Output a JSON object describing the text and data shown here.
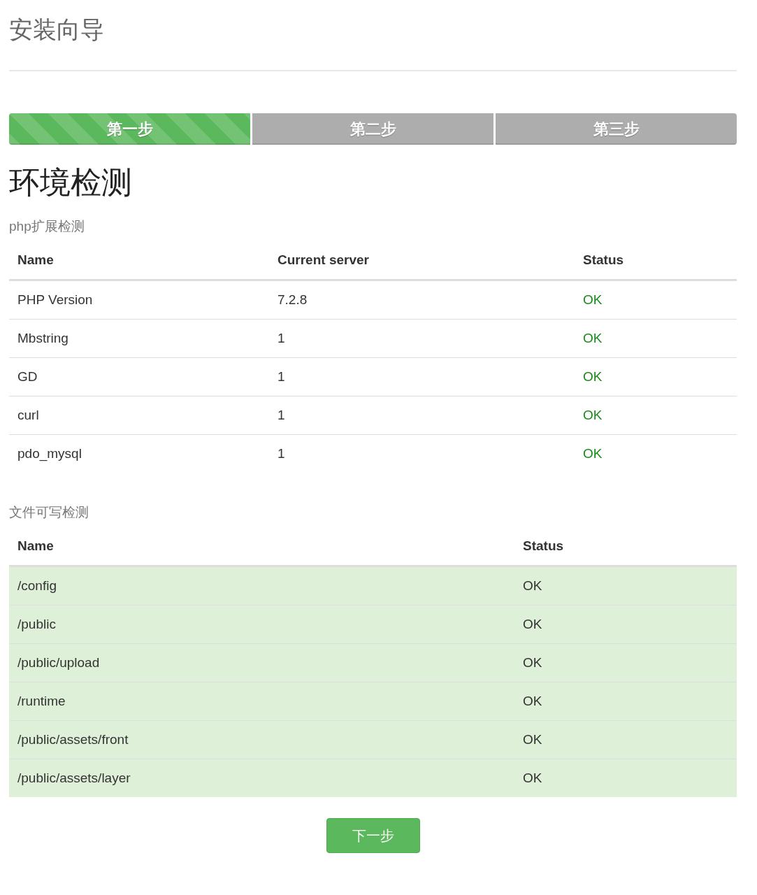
{
  "title": "安装向导",
  "steps": [
    {
      "label": "第一步",
      "selected": true
    },
    {
      "label": "第二步",
      "selected": false
    },
    {
      "label": "第三步",
      "selected": false
    }
  ],
  "heading": "环境检测",
  "extensions": {
    "caption": "php扩展检测",
    "columns": [
      "Name",
      "Current server",
      "Status"
    ],
    "rows": [
      {
        "name": "PHP Version",
        "current": "7.2.8",
        "status": "OK",
        "passed": true
      },
      {
        "name": "Mbstring",
        "current": "1",
        "status": "OK",
        "passed": true
      },
      {
        "name": "GD",
        "current": "1",
        "status": "OK",
        "passed": true
      },
      {
        "name": "curl",
        "current": "1",
        "status": "OK",
        "passed": true
      },
      {
        "name": "pdo_mysql",
        "current": "1",
        "status": "OK",
        "passed": true
      }
    ]
  },
  "files": {
    "caption": "文件可写检测",
    "columns": [
      "Name",
      "Status"
    ],
    "rows": [
      {
        "name": "/config",
        "status": "OK",
        "writable": true
      },
      {
        "name": "/public",
        "status": "OK",
        "writable": true
      },
      {
        "name": "/public/upload",
        "status": "OK",
        "writable": true
      },
      {
        "name": "/runtime",
        "status": "OK",
        "writable": true
      },
      {
        "name": "/public/assets/front",
        "status": "OK",
        "writable": true
      },
      {
        "name": "/public/assets/layer",
        "status": "OK",
        "writable": true
      }
    ]
  },
  "next_button": "下一步"
}
